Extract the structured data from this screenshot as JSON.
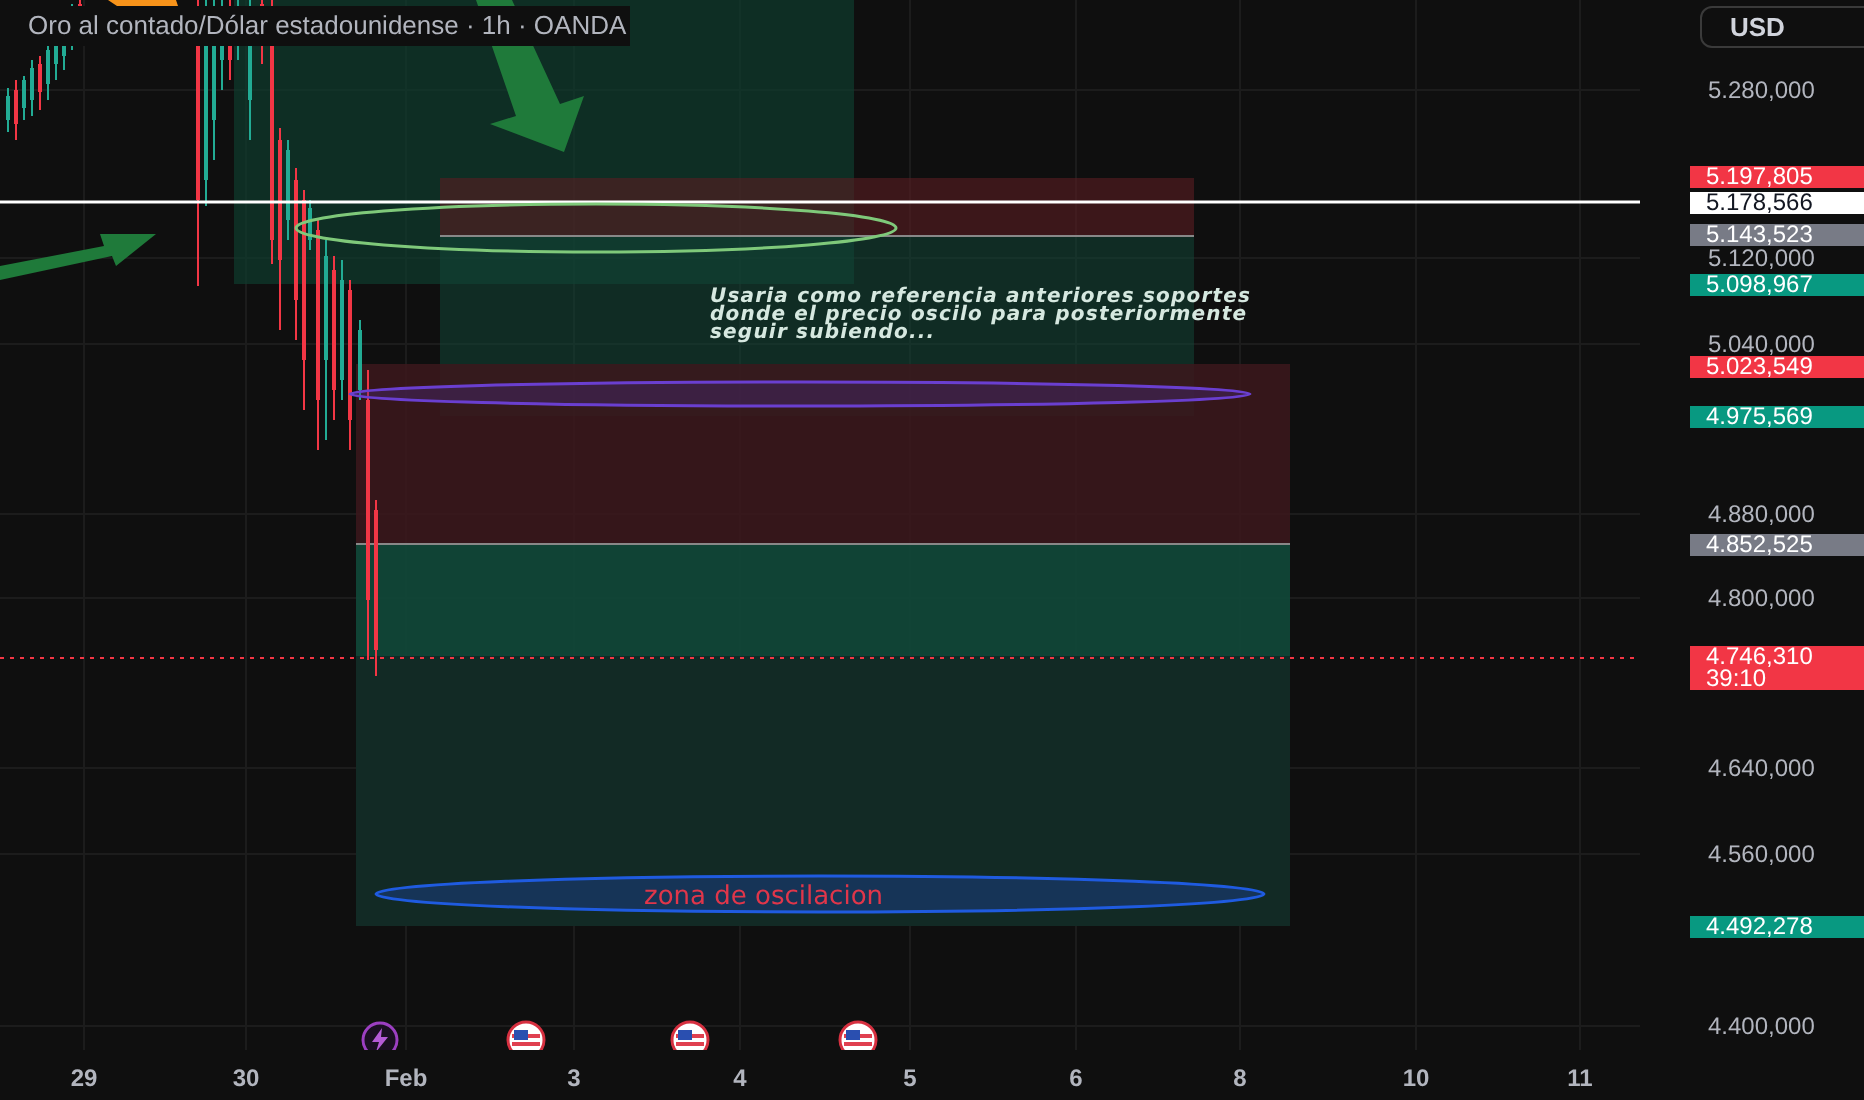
{
  "header": {
    "title": "Oro al contado/Dólar estadounidense · 1h · OANDA"
  },
  "currency_button": {
    "label": "USD"
  },
  "price_axis": {
    "ticks": [
      "5.280,000",
      "5.120,000",
      "5.040,000",
      "4.880,000",
      "4.800,000",
      "4.640,000",
      "4.560,000",
      "4.400,000"
    ]
  },
  "price_badges": [
    {
      "text": "5.197,805",
      "color": "#f23645"
    },
    {
      "text": "5.178,566",
      "color": "#ffffff"
    },
    {
      "text": "5.143,523",
      "color": "#787b86"
    },
    {
      "text": "5.098,967",
      "color": "#089981"
    },
    {
      "text": "5.023,549",
      "color": "#f23645"
    },
    {
      "text": "4.975,569",
      "color": "#089981"
    },
    {
      "text": "4.852,525",
      "color": "#787b86"
    },
    {
      "text": "4.746,310",
      "countdown": "39:10",
      "color": "#f23645"
    },
    {
      "text": "4.492,278",
      "color": "#089981"
    }
  ],
  "time_axis": {
    "labels": [
      "29",
      "30",
      "Feb",
      "3",
      "4",
      "5",
      "6",
      "8",
      "10",
      "11"
    ]
  },
  "annotations": [
    {
      "kind": "note",
      "text": "Usaria como referencia anteriores soportes\ndonde el precio oscilo para posteriormente\nseguir subiendo..."
    },
    {
      "kind": "zone_label",
      "text": "zona de oscilacion"
    }
  ],
  "events": [
    {
      "kind": "lightning"
    },
    {
      "kind": "flag"
    },
    {
      "kind": "flag"
    },
    {
      "kind": "flag"
    }
  ]
}
